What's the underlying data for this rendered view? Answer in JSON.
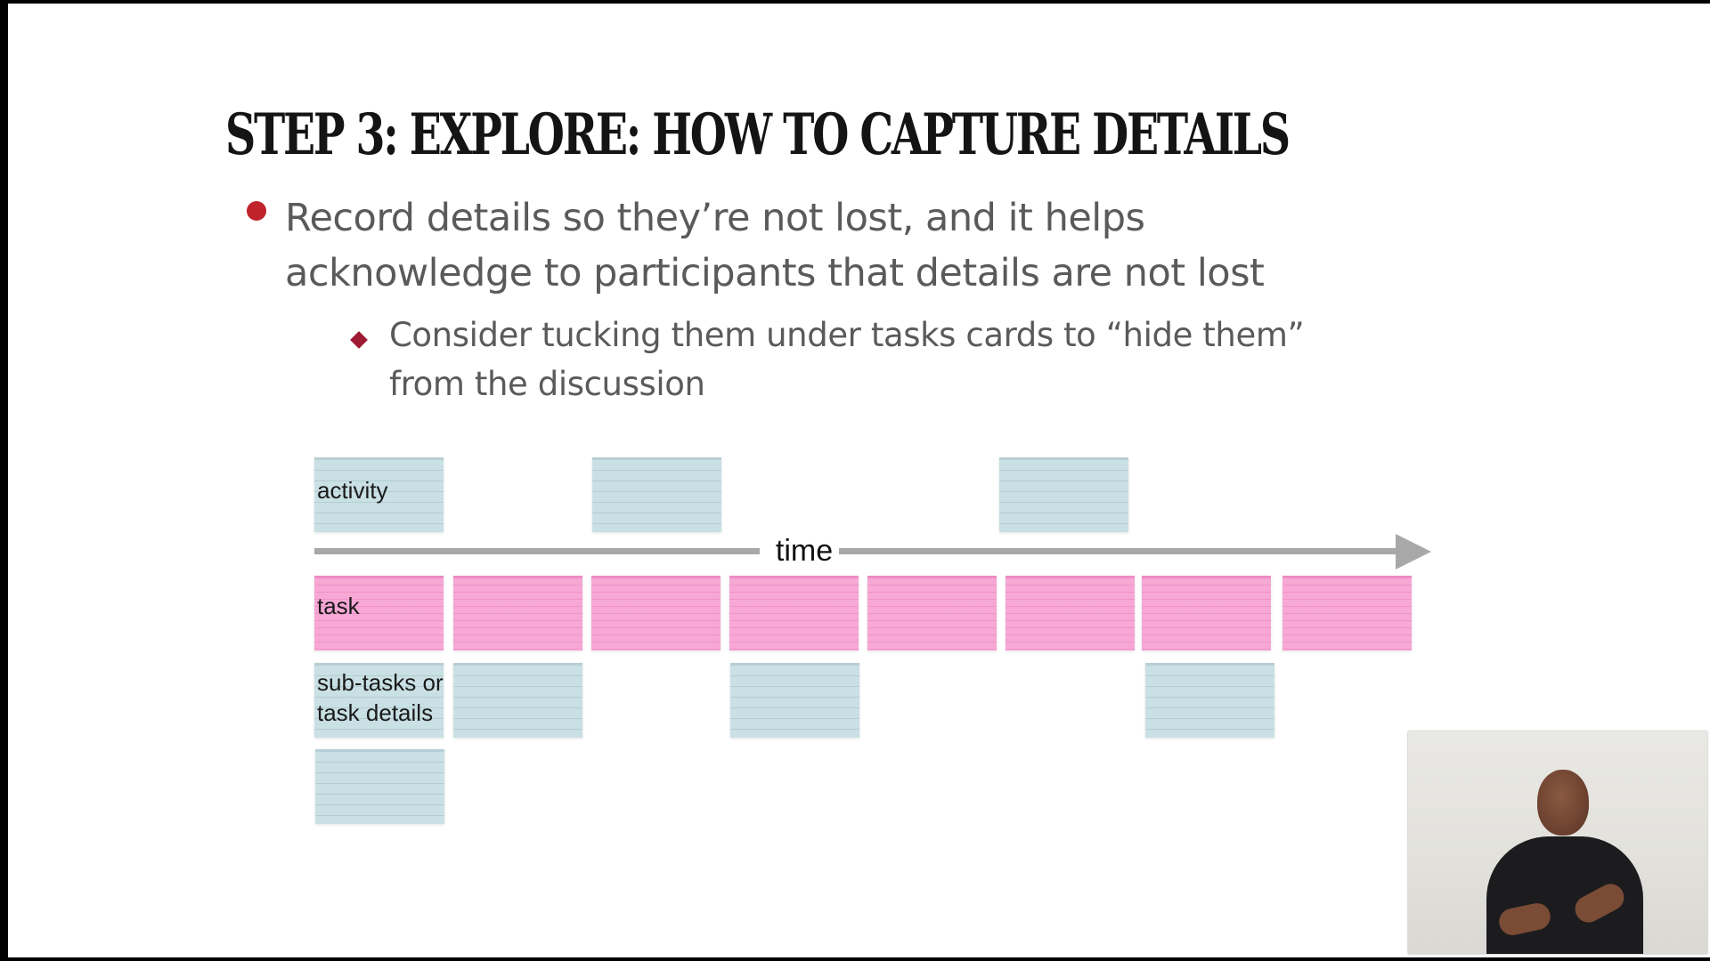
{
  "slide": {
    "title": "STEP 3: EXPLORE: HOW TO CAPTURE DETAILS",
    "bullets": [
      {
        "text": "Record details so they’re not lost, and it helps acknowledge to participants that details are not lost",
        "sub_bullets": [
          {
            "text": "Consider tucking them under tasks cards to “hide them” from the discussion"
          }
        ]
      }
    ]
  },
  "diagram": {
    "axis_label": "time",
    "activity_label": "activity",
    "task_label": "task",
    "subtask_label_line1": "sub-tasks or",
    "subtask_label_line2": "task details"
  },
  "colors": {
    "bullet_red": "#c0232c",
    "sub_bullet_red": "#9e1b33",
    "task_card_pink": "#f7a8d5",
    "detail_card_blue": "#c9e0e4",
    "timeline_gray": "#a8a8a8"
  },
  "icons": {
    "bullet": "filled-circle-bullet-icon",
    "sub_bullet": "diamond-bullet-icon",
    "timeline": "arrow-right-icon"
  }
}
